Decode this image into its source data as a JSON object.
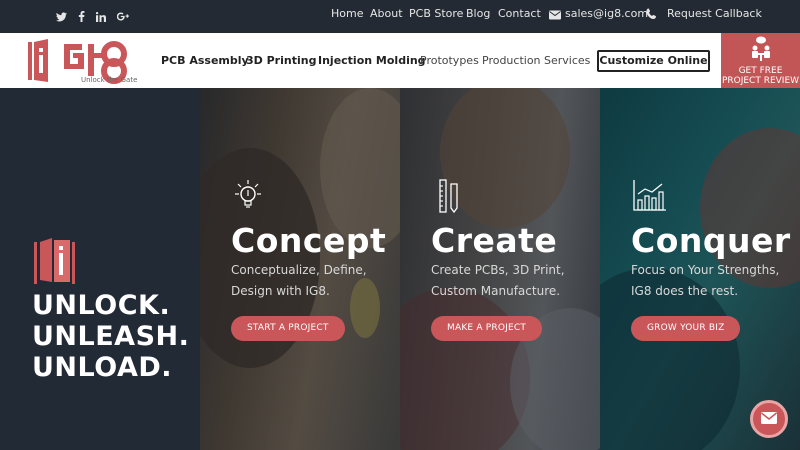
{
  "topbar": {
    "social": [
      {
        "name": "twitter-icon",
        "glyph": "🐦"
      },
      {
        "name": "facebook-icon",
        "glyph": "f"
      },
      {
        "name": "linkedin-icon",
        "glyph": "in"
      },
      {
        "name": "google-plus-icon",
        "glyph": "g+"
      }
    ],
    "links": {
      "home": "Home",
      "about": "About",
      "store": "PCB Store",
      "blog": "Blog",
      "contact": "Contact",
      "email": "sales@ig8.com",
      "callback": "Request Callback"
    }
  },
  "nav": {
    "logo_text": "iG8",
    "logo_tagline": "Unlock the Gate",
    "items": {
      "pcb": "PCB Assembly",
      "printing": "3D Printing",
      "injection": "Injection Molding",
      "prototypes": "Prototypes",
      "production": "Production",
      "services": "Services"
    },
    "cta": "Customize Online",
    "review_line1": "GET FREE",
    "review_line2": "PROJECT REVIEW"
  },
  "hero": {
    "tagline": [
      "UNLOCK.",
      "UNLEASH.",
      "UNLOAD."
    ],
    "panels": [
      {
        "title": "Concept",
        "desc": "Conceptualize, Define, Design with IG8.",
        "button": "START A PROJECT",
        "icon": "lightbulb-icon"
      },
      {
        "title": "Create",
        "desc": "Create PCBs, 3D Print, Custom Manufacture.",
        "button": "MAKE A PROJECT",
        "icon": "ruler-pencil-icon"
      },
      {
        "title": "Conquer",
        "desc": "Focus on Your Strengths, IG8 does the rest.",
        "button": "GROW YOUR BIZ",
        "icon": "bar-chart-icon"
      }
    ]
  },
  "colors": {
    "accent": "#c9575a",
    "dark": "#232a33",
    "review_bg": "#c25555"
  }
}
